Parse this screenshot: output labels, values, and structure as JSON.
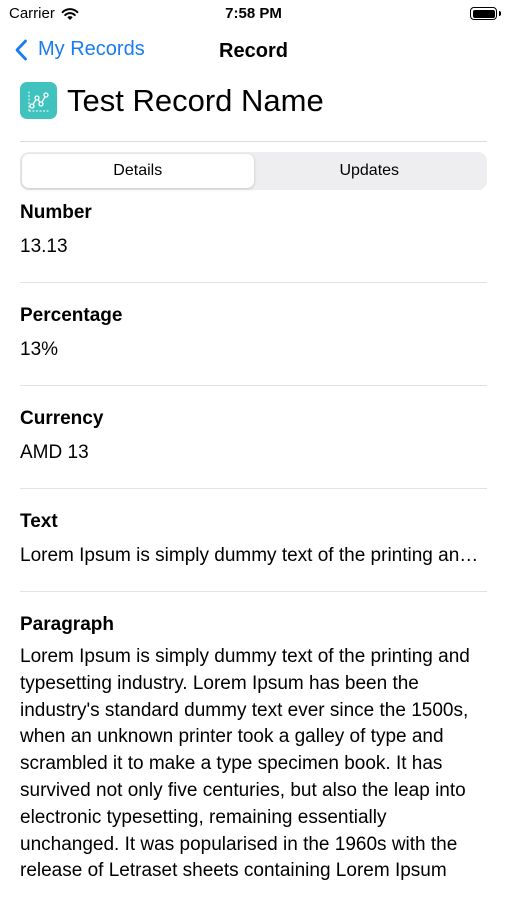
{
  "status": {
    "carrier": "Carrier",
    "time": "7:58 PM"
  },
  "nav": {
    "back_label": "My Records",
    "title": "Record"
  },
  "record": {
    "name": "Test Record Name"
  },
  "tabs": {
    "details": "Details",
    "updates": "Updates"
  },
  "fields": {
    "number": {
      "label": "Number",
      "value": "13.13"
    },
    "percentage": {
      "label": "Percentage",
      "value": "13%"
    },
    "currency": {
      "label": "Currency",
      "value": "AMD 13"
    },
    "text": {
      "label": "Text",
      "value": "Lorem Ipsum is simply dummy text of the printing and typesetting industry."
    },
    "paragraph": {
      "label": "Paragraph",
      "value": "Lorem Ipsum is simply dummy text of the printing and typesetting industry. Lorem Ipsum has been the industry's standard dummy text ever since the 1500s, when an unknown printer took a galley of type and scrambled it to make a type specimen book. It has survived not only five centuries, but also the leap into electronic typesetting, remaining essentially unchanged. It was popularised in the 1960s with the release of Letraset sheets containing Lorem Ipsum"
    }
  },
  "colors": {
    "accent": "#1a7cf2",
    "icon_bg": "#40c3be"
  }
}
